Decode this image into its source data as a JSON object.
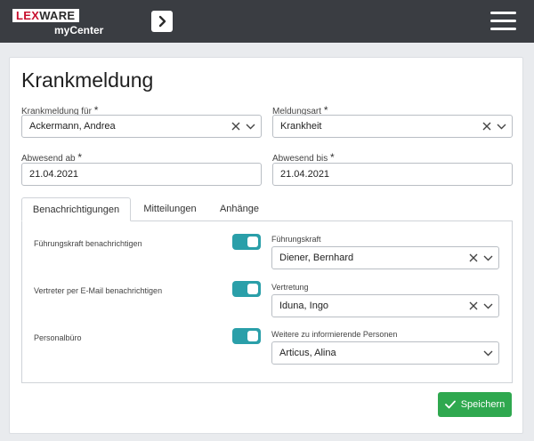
{
  "header": {
    "logo_brand_a": "LEX",
    "logo_brand_b": "WARE",
    "logo_sub": "myCenter"
  },
  "form": {
    "title": "Krankmeldung",
    "required_mark": "*",
    "krankmeldung_fuer": {
      "label": "Krankmeldung für",
      "value": "Ackermann, Andrea"
    },
    "meldungsart": {
      "label": "Meldungsart",
      "value": "Krankheit"
    },
    "abwesend_ab": {
      "label": "Abwesend ab",
      "value": "21.04.2021"
    },
    "abwesend_bis": {
      "label": "Abwesend bis",
      "value": "21.04.2021"
    }
  },
  "tabs": [
    {
      "label": "Benachrichtigungen",
      "active": true
    },
    {
      "label": "Mitteilungen",
      "active": false
    },
    {
      "label": "Anhänge",
      "active": false
    }
  ],
  "notifications": {
    "rows": [
      {
        "label": "Führungskraft benachrichtigen",
        "toggle_on": true
      },
      {
        "label": "Vertreter per E-Mail benachrichtigen",
        "toggle_on": true
      },
      {
        "label": "Personalbüro",
        "toggle_on": true
      }
    ],
    "fuehrungskraft": {
      "label": "Führungskraft",
      "value": "Diener, Bernhard"
    },
    "vertretung": {
      "label": "Vertretung",
      "value": "Iduna, Ingo"
    },
    "weitere": {
      "label": "Weitere zu informierende Personen",
      "value": "Articus, Alina"
    }
  },
  "actions": {
    "save_label": "Speichern"
  },
  "colors": {
    "accent_toggle": "#2a9fa9",
    "save_button": "#2fa84f",
    "topbar": "#3a3d42",
    "brand_red": "#c8102e"
  },
  "icons": [
    "chevron-right-icon",
    "menu-icon",
    "clear-icon",
    "chevron-down-icon",
    "check-icon"
  ]
}
